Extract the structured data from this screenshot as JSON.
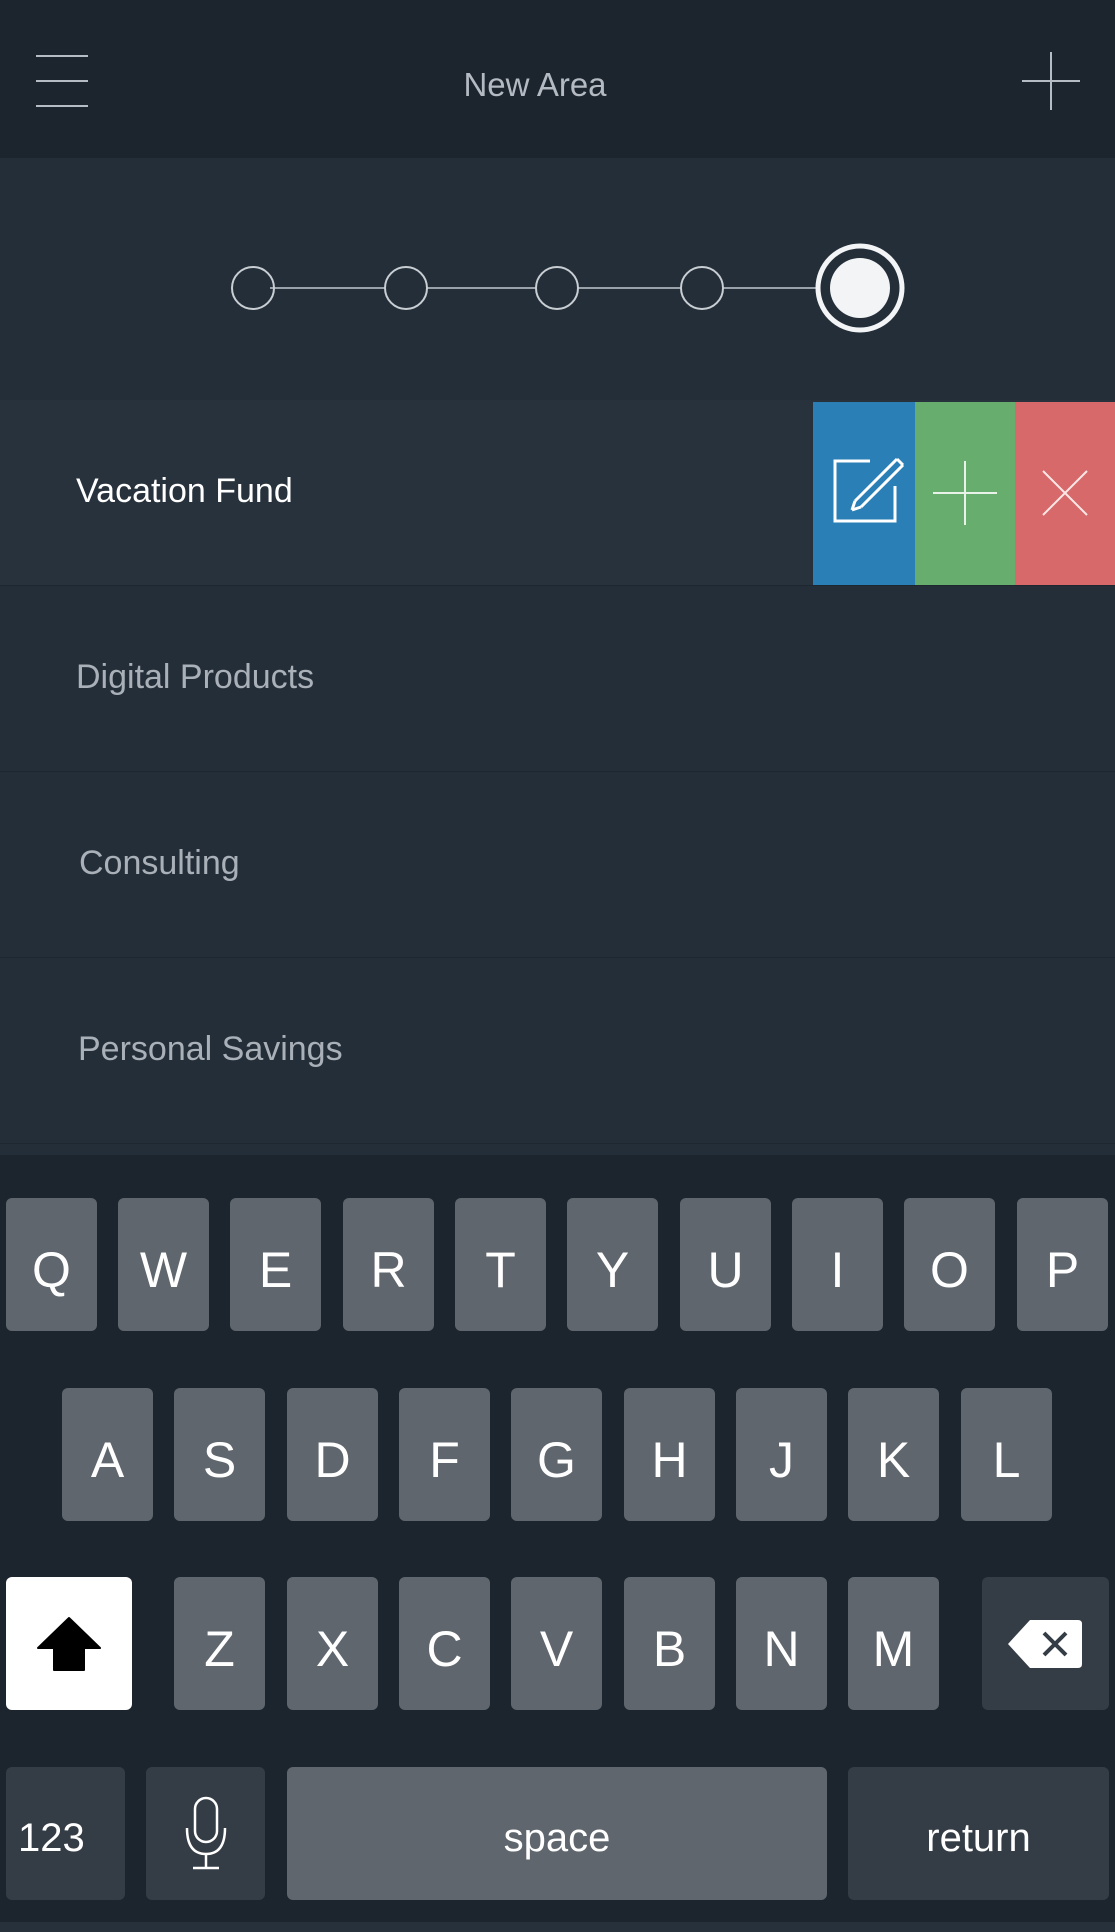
{
  "header": {
    "title": "New Area"
  },
  "stepper": {
    "step_count": 5,
    "current_step": 5
  },
  "list": {
    "items": [
      {
        "label": "Vacation Fund",
        "active": true
      },
      {
        "label": "Digital Products",
        "active": false
      },
      {
        "label": "Consulting",
        "active": false
      },
      {
        "label": "Personal Savings",
        "active": false
      }
    ]
  },
  "row_actions": {
    "icons": [
      "edit-icon",
      "plus-icon",
      "close-icon"
    ],
    "colors": [
      "#2a7fb6",
      "#66ad6e",
      "#d7696a"
    ]
  },
  "keyboard": {
    "row1": [
      "Q",
      "W",
      "E",
      "R",
      "T",
      "Y",
      "U",
      "I",
      "O",
      "P"
    ],
    "row2": [
      "A",
      "S",
      "D",
      "F",
      "G",
      "H",
      "J",
      "K",
      "L"
    ],
    "row3": [
      "Z",
      "X",
      "C",
      "V",
      "B",
      "N",
      "M"
    ],
    "numbers_label": "123",
    "space_label": "space",
    "return_label": "return"
  }
}
